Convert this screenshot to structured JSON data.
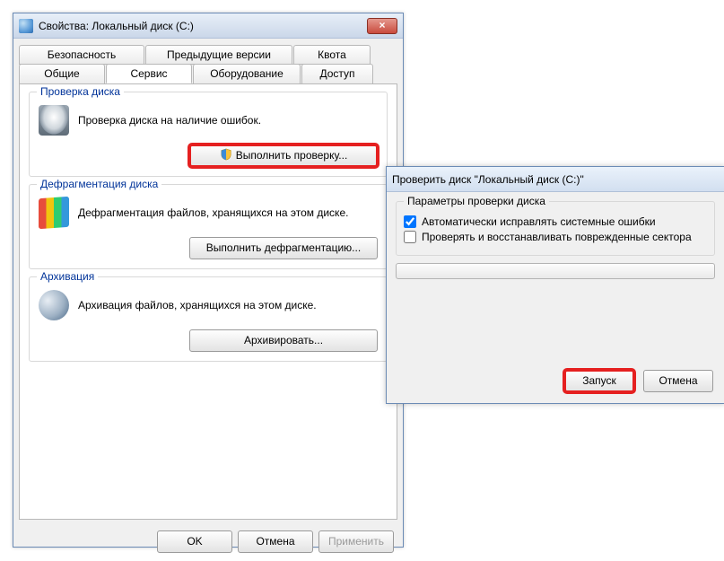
{
  "props": {
    "title": "Свойства: Локальный диск (C:)",
    "tabs_top": [
      "Безопасность",
      "Предыдущие версии",
      "Квота"
    ],
    "tabs_bottom": [
      "Общие",
      "Сервис",
      "Оборудование",
      "Доступ"
    ],
    "active_tab": "Сервис",
    "group_check": {
      "legend": "Проверка диска",
      "desc": "Проверка диска на наличие ошибок.",
      "button": "Выполнить проверку..."
    },
    "group_defrag": {
      "legend": "Дефрагментация диска",
      "desc": "Дефрагментация файлов, хранящихся на этом диске.",
      "button": "Выполнить дефрагментацию..."
    },
    "group_backup": {
      "legend": "Архивация",
      "desc": "Архивация файлов, хранящихся на этом диске.",
      "button": "Архивировать..."
    },
    "buttons": {
      "ok": "OK",
      "cancel": "Отмена",
      "apply": "Применить"
    }
  },
  "checkdisk": {
    "title": "Проверить диск \"Локальный диск (C:)\"",
    "group_legend": "Параметры проверки диска",
    "opt1": "Автоматически исправлять системные ошибки",
    "opt2": "Проверять и восстанавливать поврежденные сектора",
    "opt1_checked": true,
    "opt2_checked": false,
    "start": "Запуск",
    "cancel": "Отмена"
  }
}
